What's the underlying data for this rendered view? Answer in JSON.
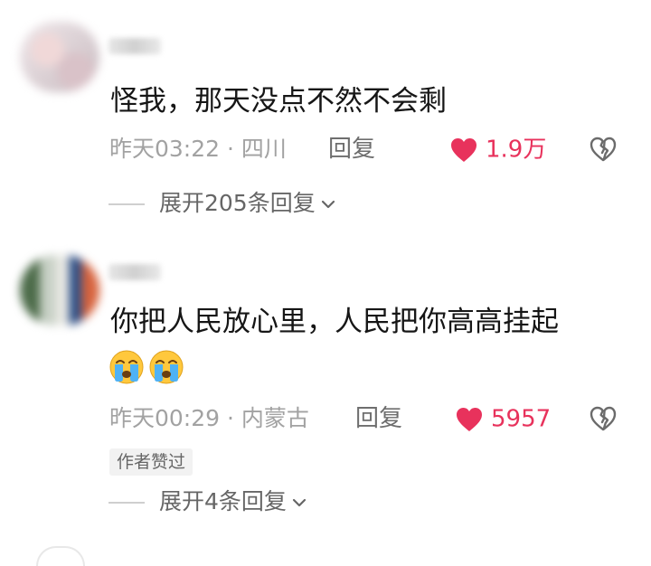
{
  "comments": [
    {
      "text": "怪我，那天没点不然不会剩",
      "time": "昨天03:22",
      "separator": "·",
      "location": "四川",
      "reply_label": "回复",
      "likes": "1.9万",
      "expand_label": "展开205条回复"
    },
    {
      "text": "你把人民放心里，人民把你高高挂起",
      "emojis": [
        "crying-face",
        "crying-face"
      ],
      "time": "昨天00:29",
      "separator": "·",
      "location": "内蒙古",
      "reply_label": "回复",
      "likes": "5957",
      "badge": "作者赞过",
      "expand_label": "展开4条回复"
    }
  ],
  "colors": {
    "like_red": "#e8325c",
    "meta_gray": "#a2a2a2",
    "badge_bg": "#f2f2f2"
  },
  "icons": {
    "like": "heart-icon",
    "dislike": "broken-heart-icon",
    "expand": "chevron-down-icon"
  }
}
